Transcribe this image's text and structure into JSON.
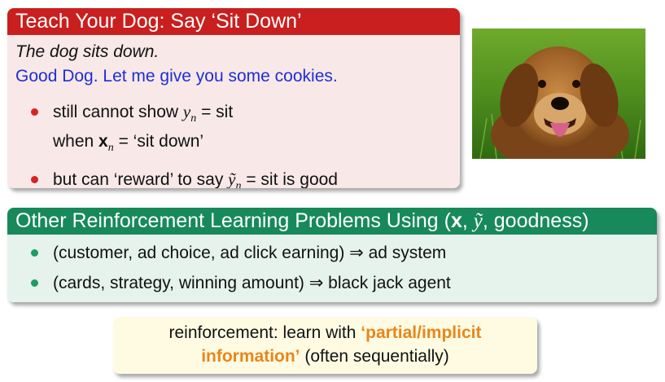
{
  "teach_block": {
    "title": "Teach Your Dog: Say ‘Sit Down’",
    "line1": "The dog sits down.",
    "line2": "Good Dog. Let me give you some cookies.",
    "bullet1_a_prefix": "still cannot show ",
    "bullet1_a_var": "y",
    "bullet1_a_sub": "n",
    "bullet1_a_suffix": " = sit",
    "bullet1_b_prefix": "when ",
    "bullet1_b_var": "x",
    "bullet1_b_sub": "n",
    "bullet1_b_suffix": " = ‘sit down’",
    "bullet2_prefix": "but can ‘reward’ to say ",
    "bullet2_var": "ỹ",
    "bullet2_sub": "n",
    "bullet2_suffix": " = sit is good"
  },
  "other_block": {
    "title_prefix": "Other Reinforcement Learning Problems Using (",
    "title_x": "x",
    "title_sep1": ", ",
    "title_y": "ỹ",
    "title_suffix": ", goodness)",
    "bullet1": "(customer, ad choice, ad click earning) ⇒ ad system",
    "bullet2": "(cards, strategy, winning amount) ⇒ black jack agent"
  },
  "note": {
    "prefix": "reinforcement: learn with ",
    "highlight1": "‘partial/implicit",
    "highlight2": "information’",
    "suffix": " (often sequentially)"
  },
  "colors": {
    "red_title": "#c91f1f",
    "green_title": "#17895a",
    "blue_text": "#1f2fd1",
    "orange_text": "#e8861a"
  }
}
